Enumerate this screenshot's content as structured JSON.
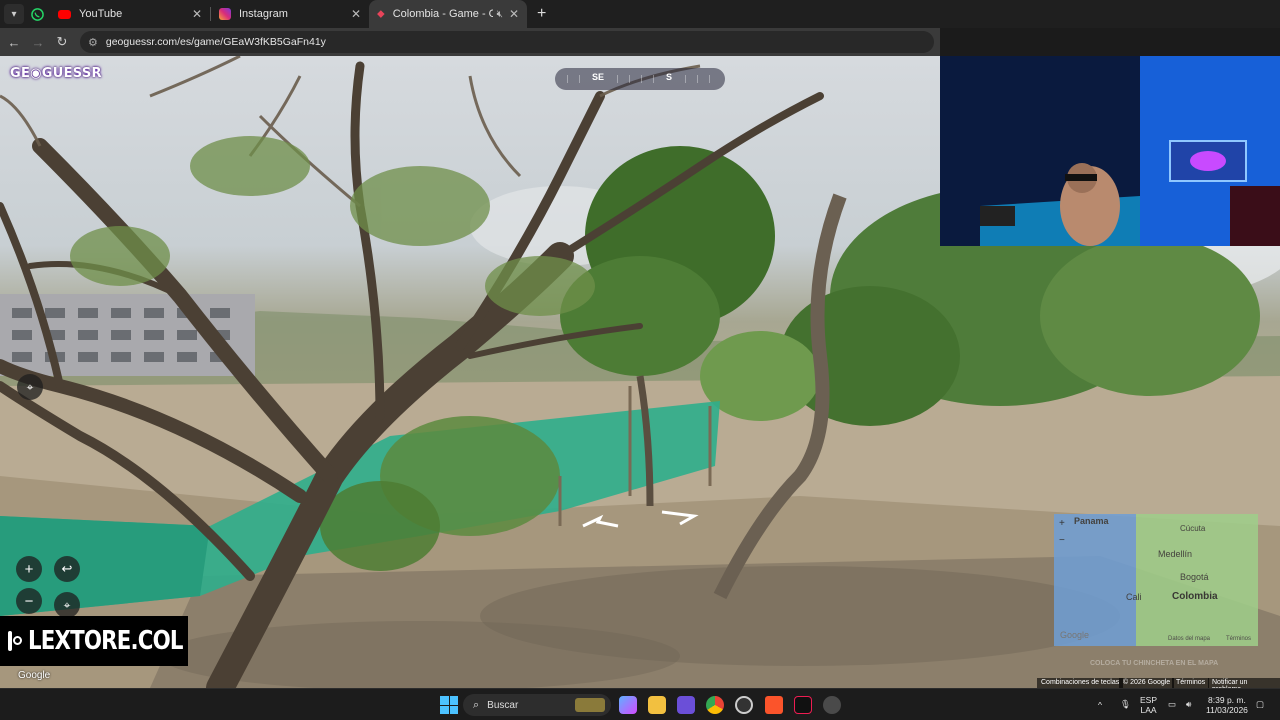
{
  "browser": {
    "tabs": [
      {
        "label": "YouTube",
        "active": false
      },
      {
        "label": "Instagram",
        "active": false
      },
      {
        "label": "Colombia - Game - GeoGu",
        "active": true
      }
    ],
    "new_tab": "+",
    "url": "geoguessr.com/es/game/GEaW3fKB5GaFn41y"
  },
  "game": {
    "logo": "GE◉GUESSR",
    "compass": {
      "left": "SE",
      "right": "S"
    },
    "zoom_in": "+",
    "zoom_out": "−",
    "google_mark": "Google"
  },
  "minimap": {
    "labels": {
      "panama": "Panama",
      "cucuta": "Cúcuta",
      "medellin": "Medellín",
      "bogota": "Bogotá",
      "cali": "Cali",
      "colombia": "Colombia",
      "google": "Google",
      "map_data": "Datos del mapa",
      "terms": "Términos"
    },
    "guess_hint": "COLOCA TU CHINCHETA EN EL MAPA"
  },
  "footer": {
    "shortcuts": "Combinaciones de teclas",
    "copyright": "© 2026 Google",
    "terms": "Términos",
    "report": "Notificar un problema"
  },
  "watermark": {
    "text": "LEXTORE.COL"
  },
  "taskbar": {
    "search": "Buscar",
    "lang_1": "ESP",
    "lang_2": "LAA",
    "time": "8:39 p. m.",
    "date": "11/03/2026"
  },
  "colors": {
    "accent": "#7a2bd8",
    "fence": "#2fae8c"
  }
}
